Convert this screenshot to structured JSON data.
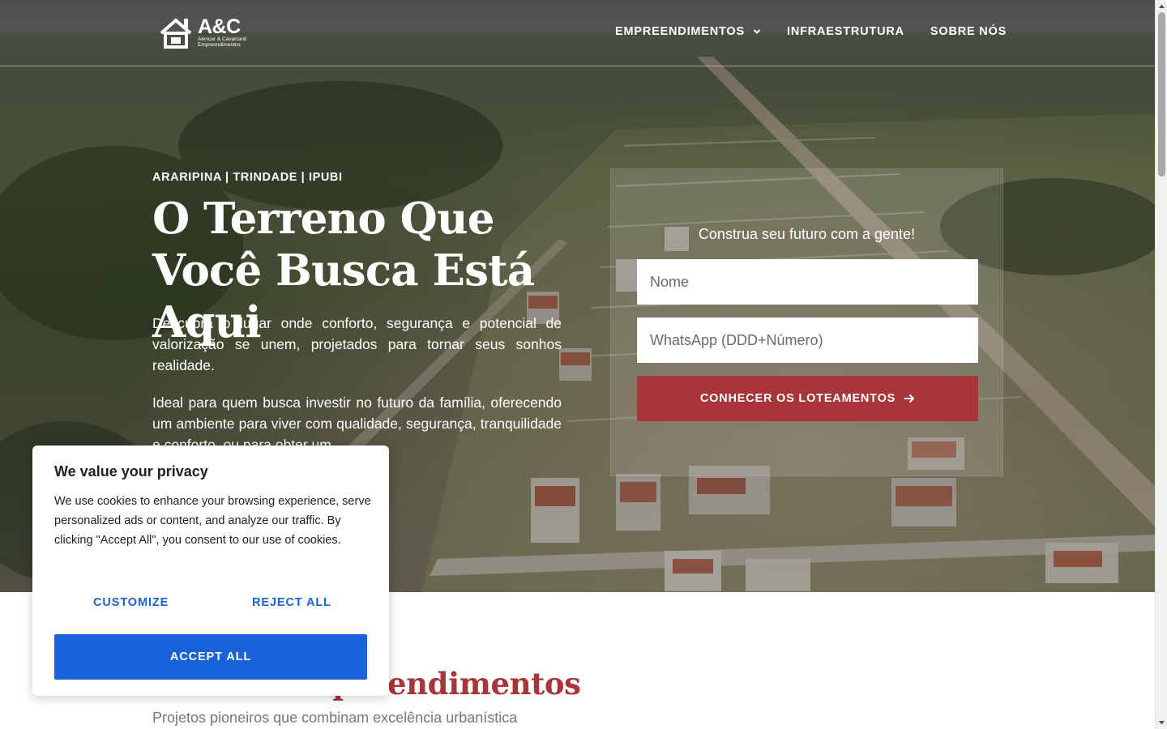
{
  "brand": {
    "logo_mark": "A&C",
    "logo_subtitle_1": "Alencar & Cavalcanti",
    "logo_subtitle_2": "Empreendimentos"
  },
  "nav": {
    "items": [
      {
        "label": "EMPREENDIMENTOS",
        "has_dropdown": true
      },
      {
        "label": "INFRAESTRUTURA",
        "has_dropdown": false
      },
      {
        "label": "SOBRE NÓS",
        "has_dropdown": false
      }
    ]
  },
  "hero": {
    "eyebrow": "ARARIPINA | TRINDADE | IPUBI",
    "headline": "O Terreno Que Você Busca Está Aqui",
    "paragraph_1": "Descubra o lugar onde conforto, segurança e potencial de valorização se unem, projetados para tornar seus sonhos realidade.",
    "paragraph_2": "Ideal para quem busca investir no futuro da família, oferecendo um ambiente para viver com qualidade, segurança, tranquilidade e conforto, ou para obter um"
  },
  "form": {
    "title": "Construa seu futuro com a gente!",
    "name_placeholder": "Nome",
    "phone_placeholder": "WhatsApp (DDD+Número)",
    "submit_label": "CONHECER OS LOTEAMENTOS",
    "submit_icon": "arrow-right-icon"
  },
  "section": {
    "title": "Nossos Empreendimentos",
    "subtitle": "Projetos pioneiros que combinam excelência urbanística"
  },
  "cookie_banner": {
    "title": "We value your privacy",
    "text": "We use cookies to enhance your browsing experience, serve personalized ads or content, and analyze our traffic. By clicking \"Accept All\", you consent to our use of cookies.",
    "customize_label": "CUSTOMIZE",
    "reject_label": "REJECT ALL",
    "accept_label": "ACCEPT ALL"
  },
  "colors": {
    "accent_red": "#a8353a",
    "cookie_blue": "#1863dc"
  }
}
